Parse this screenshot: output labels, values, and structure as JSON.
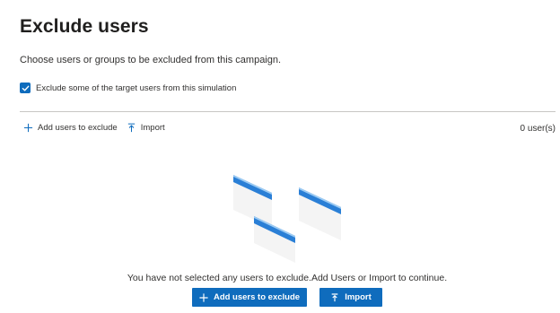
{
  "page": {
    "title": "Exclude users",
    "description": "Choose users or groups to be excluded from this campaign."
  },
  "checkbox": {
    "label": "Exclude some of the target users from this simulation",
    "checked": true
  },
  "toolbar": {
    "add_label": "Add users to exclude",
    "import_label": "Import",
    "count_label": "0 user(s)"
  },
  "empty_state": {
    "message": "You have not selected any users to exclude.Add Users or Import to continue.",
    "add_button_label": "Add users to exclude",
    "import_button_label": "Import"
  },
  "colors": {
    "accent": "#0f6cbd",
    "divider": "#c8c6c4"
  },
  "icons": [
    "check-icon",
    "add-icon",
    "import-icon"
  ]
}
